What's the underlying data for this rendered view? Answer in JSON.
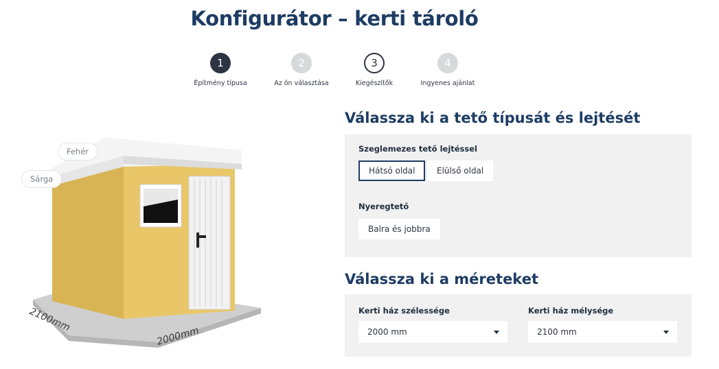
{
  "title": "Konfigurátor – kerti tároló",
  "steps": [
    {
      "number": "1",
      "label": "Építmény típusa",
      "state": "active"
    },
    {
      "number": "2",
      "label": "Az ön választása",
      "state": "inactive"
    },
    {
      "number": "3",
      "label": "Kiegészítők",
      "state": "outlined"
    },
    {
      "number": "4",
      "label": "Ingyenes ajánlat",
      "state": "inactive"
    }
  ],
  "preview": {
    "swatches": [
      "Fehér",
      "Sárga"
    ],
    "dimension_width": "2000mm",
    "dimension_depth": "2100mm"
  },
  "roof": {
    "heading": "Válassza ki a tető típusát és lejtését",
    "groups": [
      {
        "label": "Szeglemezes tető lejtéssel",
        "options": [
          "Hátsó oldal",
          "Elülső oldal"
        ],
        "selected": "Hátsó oldal"
      },
      {
        "label": "Nyeregtető",
        "options": [
          "Balra és jobbra"
        ]
      }
    ]
  },
  "dimensions": {
    "heading": "Válassza ki a méreteket",
    "width_label": "Kerti ház szélessége",
    "width_value": "2000 mm",
    "depth_label": "Kerti ház mélysége",
    "depth_value": "2100 mm"
  },
  "colors": {
    "accent": "#1d3c64",
    "step_active": "#2d3442",
    "step_inactive": "#d8d9db",
    "panel_bg": "#f1f1f1",
    "shed_wall": "#e9c769"
  }
}
